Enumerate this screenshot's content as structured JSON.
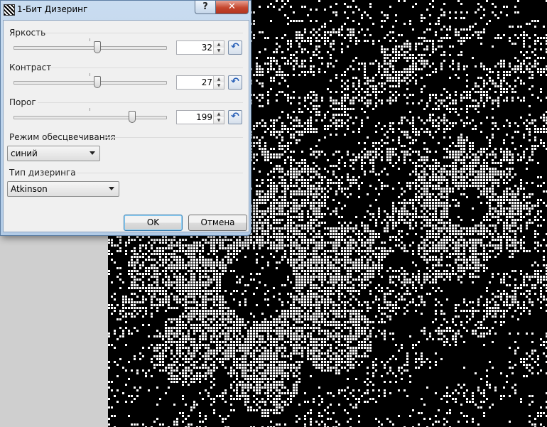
{
  "dialog": {
    "title": "1-Бит Дизеринг",
    "help_label": "?",
    "close_label": "✕",
    "brightness": {
      "label": "Яркость",
      "value": "32",
      "level": 0.55
    },
    "contrast": {
      "label": "Контраст",
      "value": "27",
      "level": 0.55
    },
    "threshold": {
      "label": "Порог",
      "value": "199",
      "level": 0.78
    },
    "reset_icon_glyph": "↶",
    "spin_up": "▲",
    "spin_down": "▼",
    "desaturation": {
      "label": "Режим обесцвечивания",
      "selected": "синий"
    },
    "dither_type": {
      "label": "Тип дизеринга",
      "selected": "Atkinson"
    },
    "ok_label": "OK",
    "cancel_label": "Отмена"
  },
  "colors": {
    "title_gradient_top": "#c9dcf0",
    "close_button": "#c4462e",
    "reset_icon": "#2b62b8",
    "canvas_background": "#000000",
    "dither_white": "#ffffff"
  },
  "icons": {
    "title": "dither-app-icon",
    "reset": "reset-arrow-icon",
    "combo": "chevron-down-icon"
  }
}
